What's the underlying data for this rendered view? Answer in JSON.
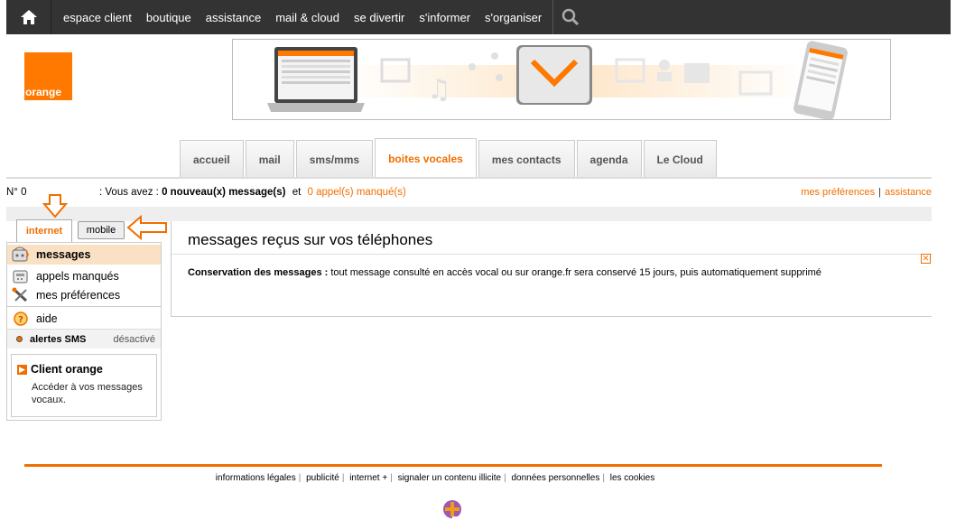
{
  "nav": {
    "links": [
      "espace client",
      "boutique",
      "assistance",
      "mail & cloud",
      "se divertir",
      "s'informer",
      "s'organiser"
    ]
  },
  "logo": {
    "text": "orange"
  },
  "tabs": [
    "accueil",
    "mail",
    "sms/mms",
    "boites vocales",
    "mes contacts",
    "agenda",
    "Le Cloud"
  ],
  "active_tab": "boites vocales",
  "status": {
    "number": "N° 0",
    "prefix": ": Vous avez :",
    "new_messages": "0 nouveau(x) message(s)",
    "et": "et",
    "missed_calls": "0 appel(s) manqué(s)",
    "prefs_link": "mes préférences",
    "assist_link": "assistance"
  },
  "left": {
    "tab_internet": "internet",
    "tab_mobile": "mobile",
    "menu": [
      {
        "label": "messages",
        "icon": "voicemail-icon"
      },
      {
        "label": "appels manqués",
        "icon": "missed-calls-icon"
      },
      {
        "label": "mes préférences",
        "icon": "tools-icon"
      },
      {
        "label": "aide",
        "icon": "help-icon"
      }
    ],
    "alertes_label": "alertes SMS",
    "alertes_status": "désactivé",
    "client_title": "Client orange",
    "client_text": "Accéder à vos messages vocaux."
  },
  "main": {
    "title": "messages reçus sur vos téléphones",
    "conserv_label": "Conservation des messages :",
    "conserv_text": " tout message consulté en accès vocal ou sur orange.fr sera conservé 15 jours, puis automatiquement supprimé"
  },
  "footer": {
    "links": [
      "informations légales",
      "publicité",
      "internet +",
      "signaler un contenu illicite",
      "données personnelles",
      "les cookies"
    ]
  },
  "colors": {
    "accent": "#f16e00",
    "nav_bg": "#333333"
  }
}
